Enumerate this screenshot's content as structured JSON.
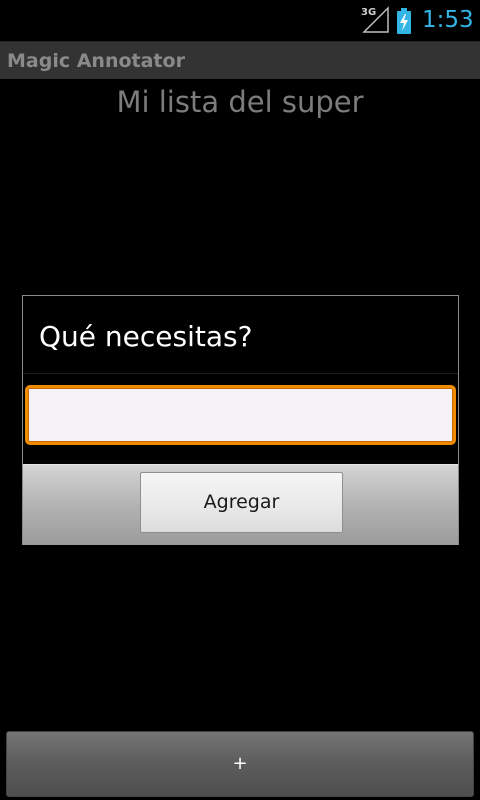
{
  "status_bar": {
    "network_label": "3G",
    "network_icon": "signal-icon",
    "battery_icon": "battery-charging-icon",
    "time": "1:53",
    "time_color": "#33b5e5"
  },
  "action_bar": {
    "title": "Magic Annotator"
  },
  "main": {
    "heading": "Mi lista del super",
    "add_item_label": "+"
  },
  "dialog": {
    "title": "Qué necesitas?",
    "input_value": "",
    "input_placeholder": "",
    "accent_color": "#f08a00",
    "confirm_label": "Agregar"
  }
}
